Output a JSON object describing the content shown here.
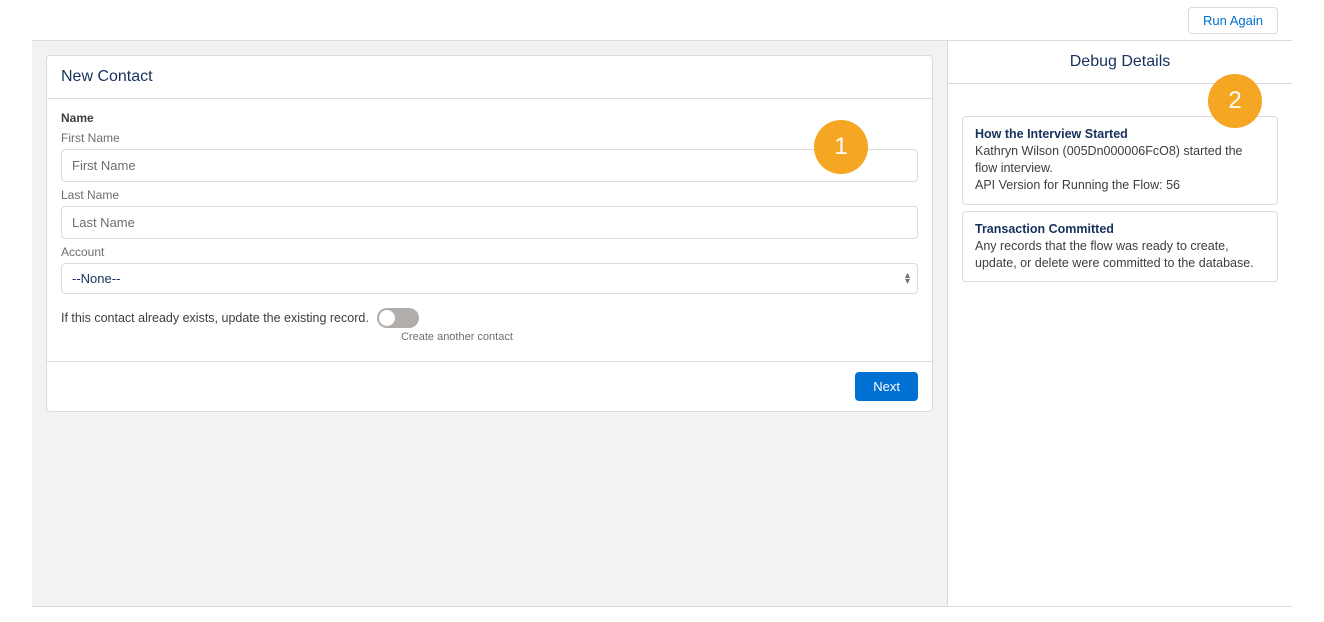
{
  "topbar": {
    "run_again_label": "Run Again"
  },
  "form": {
    "title": "New Contact",
    "section_name": "Name",
    "first_name_label": "First Name",
    "first_name_placeholder": "First Name",
    "last_name_label": "Last Name",
    "last_name_placeholder": "Last Name",
    "account_label": "Account",
    "account_value": "--None--",
    "toggle_text": "If this contact already exists, update the existing record.",
    "toggle_caption": "Create another contact",
    "next_label": "Next"
  },
  "debug": {
    "title": "Debug Details",
    "cards": [
      {
        "title": "How the Interview Started",
        "line1": "Kathryn Wilson (005Dn000006FcO8) started the flow interview.",
        "line2": "API Version for Running the Flow: 56"
      },
      {
        "title": "Transaction Committed",
        "line1": "Any records that the flow was ready to create, update, or delete were committed to the database."
      }
    ]
  },
  "markers": {
    "one": "1",
    "two": "2"
  }
}
